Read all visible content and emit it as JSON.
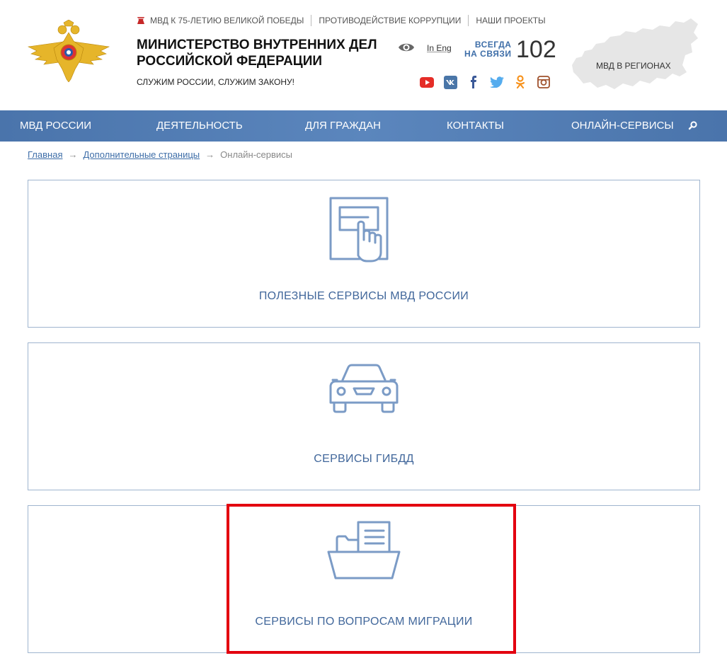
{
  "header": {
    "top_links": [
      {
        "label": "МВД К 75-ЛЕТИЮ ВЕЛИКОЙ ПОБЕДЫ",
        "icon": "victory-75-icon"
      },
      {
        "label": "ПРОТИВОДЕЙСТВИЕ КОРРУПЦИИ"
      },
      {
        "label": "НАШИ ПРОЕКТЫ"
      }
    ],
    "title": "МИНИСТЕРСТВО ВНУТРЕННИХ ДЕЛ РОССИЙСКОЙ ФЕДЕРАЦИИ",
    "slogan": "СЛУЖИМ РОССИИ, СЛУЖИМ ЗАКОНУ!",
    "lang_link": "In Eng",
    "always_line1": "ВСЕГДА",
    "always_line2": "НА СВЯЗИ",
    "phone": "102",
    "regions_label": "МВД В РЕГИОНАХ",
    "socials": [
      "youtube-icon",
      "vk-icon",
      "facebook-icon",
      "twitter-icon",
      "odnoklassniki-icon",
      "instagram-icon"
    ]
  },
  "nav": {
    "items": [
      "МВД РОССИИ",
      "ДЕЯТЕЛЬНОСТЬ",
      "ДЛЯ ГРАЖДАН",
      "КОНТАКТЫ",
      "ОНЛАЙН-СЕРВИСЫ"
    ]
  },
  "breadcrumb": {
    "items": [
      "Главная",
      "Дополнительные страницы"
    ],
    "current": "Онлайн-сервисы",
    "separator": "→"
  },
  "cards": [
    {
      "label": "ПОЛЕЗНЫЕ СЕРВИСЫ МВД РОССИИ",
      "icon": "touch-terminal-icon"
    },
    {
      "label": "СЕРВИСЫ ГИБДД",
      "icon": "car-icon"
    },
    {
      "label": "СЕРВИСЫ ПО ВОПРОСАМ МИГРАЦИИ",
      "icon": "folder-document-icon"
    }
  ],
  "colors": {
    "nav_bg": "#4a74ab",
    "accent_text": "#41679b",
    "card_border": "#9fb5cf",
    "highlight": "#e3000f",
    "icon_stroke": "#7b9bc6"
  }
}
